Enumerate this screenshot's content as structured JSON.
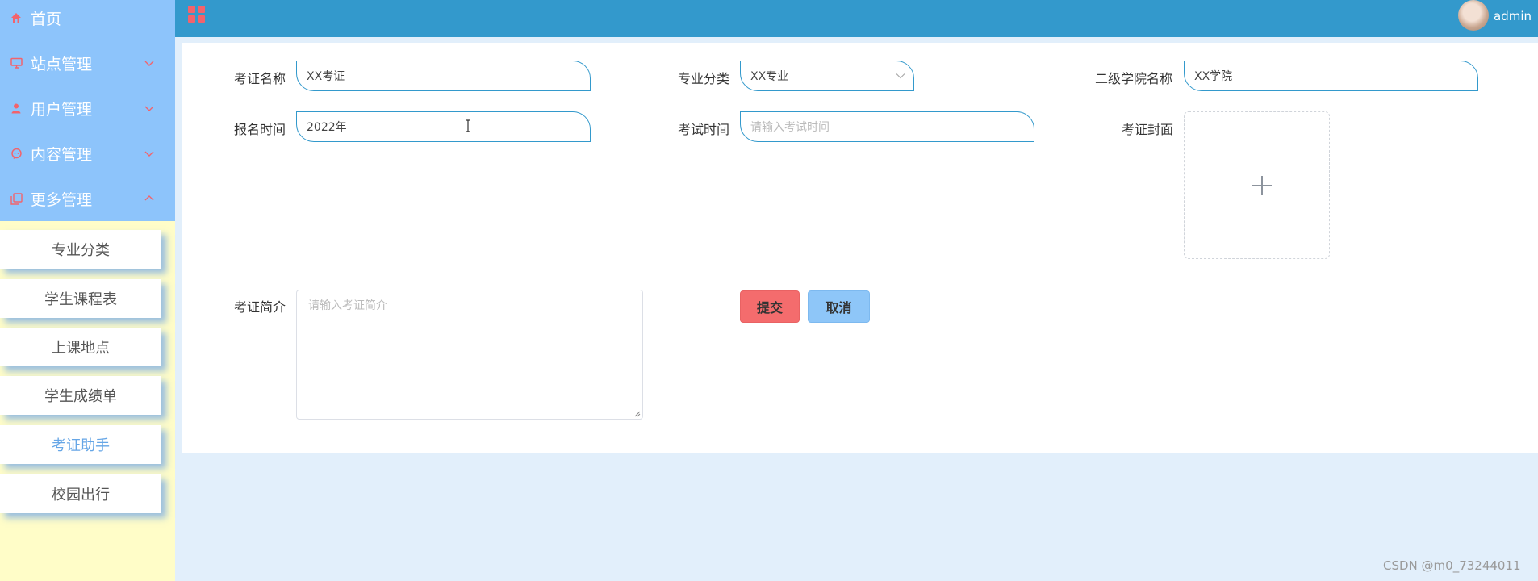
{
  "sidebar": {
    "items": [
      {
        "label": "首页",
        "icon": "home-icon"
      },
      {
        "label": "站点管理",
        "icon": "monitor-icon"
      },
      {
        "label": "用户管理",
        "icon": "user-icon"
      },
      {
        "label": "内容管理",
        "icon": "chat-icon"
      },
      {
        "label": "更多管理",
        "icon": "copy-icon"
      }
    ],
    "submenu": [
      {
        "label": "专业分类"
      },
      {
        "label": "学生课程表"
      },
      {
        "label": "上课地点"
      },
      {
        "label": "学生成绩单"
      },
      {
        "label": "考证助手",
        "active": true
      },
      {
        "label": "校园出行"
      }
    ]
  },
  "header": {
    "user_name": "admin"
  },
  "form": {
    "cert_name": {
      "label": "考证名称",
      "value": "XX考证"
    },
    "major": {
      "label": "专业分类",
      "value": "XX专业"
    },
    "college": {
      "label": "二级学院名称",
      "value": "XX学院"
    },
    "reg_time": {
      "label": "报名时间",
      "value": "2022年"
    },
    "exam_time": {
      "label": "考试时间",
      "placeholder": "请输入考试时间"
    },
    "cover": {
      "label": "考证封面"
    },
    "intro": {
      "label": "考证简介",
      "placeholder": "请输入考证简介"
    },
    "submit_label": "提交",
    "cancel_label": "取消"
  },
  "watermark": "CSDN @m0_73244011",
  "colors": {
    "accent": "#3399cc",
    "sidebar_top": "#8dc4fb",
    "sidebar_bottom": "#fffdc8",
    "icon_red": "#f2636c",
    "submit": "#f46c6d",
    "cancel": "#8ec6f8"
  }
}
